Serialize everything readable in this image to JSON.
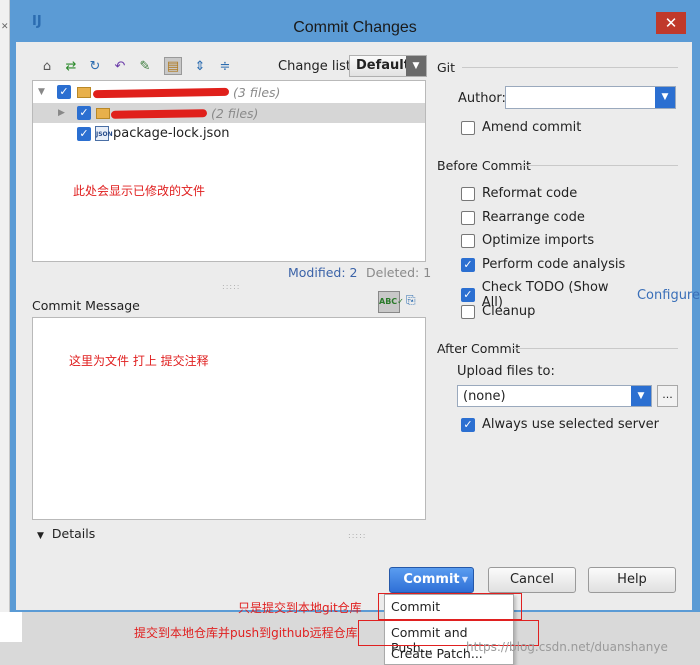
{
  "window": {
    "title": "Commit Changes",
    "app_icon": "intellij-idea-icon",
    "close_glyph": "✕"
  },
  "toolbar": {
    "icons": [
      "vcs-branch-icon",
      "move-to-changelist-icon",
      "refresh-icon",
      "rollback-icon",
      "diff-icon",
      "group-by-directory-icon",
      "expand-all-icon",
      "collapse-all-icon"
    ],
    "changelist_label": "Change list:",
    "changelist_value": "Default"
  },
  "tree": {
    "items": [
      {
        "label": "(3 files)",
        "checked": true,
        "type": "folder",
        "redacted": true
      },
      {
        "label": "(2 files)",
        "checked": true,
        "type": "folder",
        "redacted": true
      },
      {
        "label": "package-lock.json",
        "checked": true,
        "type": "json-file",
        "redacted": false
      }
    ],
    "annotation": "此处会显示已修改的文件"
  },
  "stats": {
    "modified": "Modified: 2",
    "deleted": "Deleted: 1"
  },
  "commit_message": {
    "label": "Commit Message",
    "value": "",
    "annotation": "这里为文件 打上 提交注释"
  },
  "details_label": "Details",
  "git": {
    "group_title": "Git",
    "author_label": "Author:",
    "author_value": "",
    "amend_label": "Amend commit",
    "amend_checked": false
  },
  "before_commit": {
    "title": "Before Commit",
    "options": [
      {
        "label": "Reformat code",
        "checked": false
      },
      {
        "label": "Rearrange code",
        "checked": false
      },
      {
        "label": "Optimize imports",
        "checked": false
      },
      {
        "label": "Perform code analysis",
        "checked": true
      },
      {
        "label": "Check TODO (Show All)",
        "checked": true,
        "link": "Configure"
      },
      {
        "label": "Cleanup",
        "checked": false
      }
    ]
  },
  "after_commit": {
    "title": "After Commit",
    "upload_label": "Upload files to:",
    "upload_value": "(none)",
    "browse_label": "...",
    "always_use_label": "Always use selected server",
    "always_use_checked": true
  },
  "buttons": {
    "commit": "Commit",
    "cancel": "Cancel",
    "help": "Help"
  },
  "commit_menu": {
    "items": [
      "Commit",
      "Commit and Push...",
      "Create Patch..."
    ],
    "annotation_commit": "只是提交到本地git仓库",
    "annotation_push": "提交到本地仓库并push到github远程仓库"
  },
  "watermark": "https://blog.csdn.net/duanshanye",
  "colors": {
    "frame": "#5b9bd5",
    "accent": "#2b6fd1",
    "annotation": "#e02020"
  }
}
